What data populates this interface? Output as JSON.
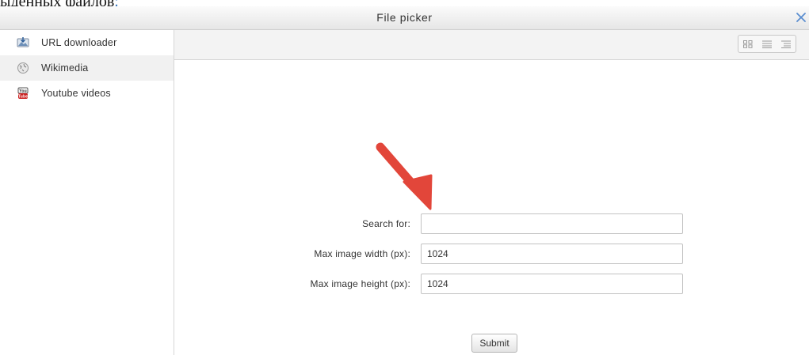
{
  "background_text": {
    "main": "ыденных файлов",
    "colon": ":"
  },
  "dialog": {
    "title": "File picker",
    "close_icon": "close-icon"
  },
  "sidebar": {
    "items": [
      {
        "label": "URL downloader",
        "icon": "url-downloader-icon",
        "active": false
      },
      {
        "label": "Wikimedia",
        "icon": "wikimedia-icon",
        "active": true
      },
      {
        "label": "Youtube videos",
        "icon": "youtube-icon",
        "active": false
      }
    ]
  },
  "toolbar": {
    "view_buttons": [
      "icons-view-icon",
      "details-view-icon",
      "tree-view-icon"
    ]
  },
  "form": {
    "search_label": "Search for:",
    "search_value": "",
    "width_label": "Max image width (px):",
    "width_value": "1024",
    "height_label": "Max image height (px):",
    "height_value": "1024",
    "submit_label": "Submit"
  },
  "colors": {
    "arrow": "#e2463a",
    "close": "#5b8ed0",
    "youtube_red": "#cc2222"
  }
}
